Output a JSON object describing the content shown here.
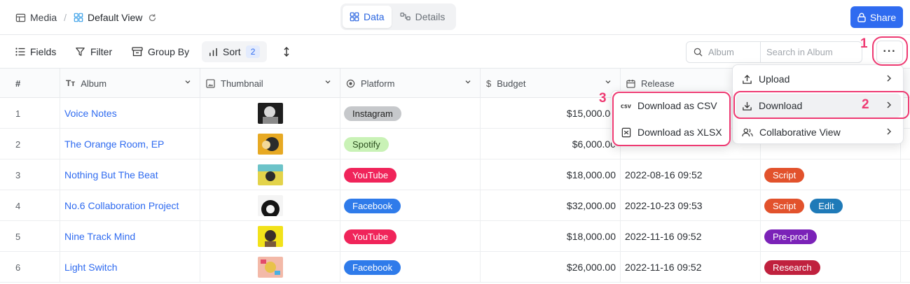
{
  "breadcrumb": {
    "root": "Media",
    "view": "Default View"
  },
  "view_switch": {
    "data_label": "Data",
    "details_label": "Details"
  },
  "share_label": "Share",
  "toolbar": {
    "fields": "Fields",
    "filter": "Filter",
    "group_by": "Group By",
    "sort": "Sort",
    "sort_count": "2"
  },
  "search": {
    "field_label": "Album",
    "placeholder": "Search in Album"
  },
  "more_label": "···",
  "columns": {
    "num": "#",
    "album": "Album",
    "thumbnail": "Thumbnail",
    "platform": "Platform",
    "budget": "Budget",
    "release": "Release"
  },
  "rows": [
    {
      "num": "1",
      "album": "Voice Notes",
      "platform": "Instagram",
      "budget": "$15,000.00",
      "release": "",
      "statuses": []
    },
    {
      "num": "2",
      "album": "The Orange Room, EP",
      "platform": "Spotify",
      "budget": "$6,000.00",
      "release": "",
      "statuses": []
    },
    {
      "num": "3",
      "album": "Nothing But The Beat",
      "platform": "YouTube",
      "budget": "$18,000.00",
      "release": "2022-08-16 09:52",
      "statuses": [
        "Script"
      ]
    },
    {
      "num": "4",
      "album": "No.6 Collaboration Project",
      "platform": "Facebook",
      "budget": "$32,000.00",
      "release": "2022-10-23 09:53",
      "statuses": [
        "Script",
        "Edit"
      ]
    },
    {
      "num": "5",
      "album": "Nine Track Mind",
      "platform": "YouTube",
      "budget": "$18,000.00",
      "release": "2022-11-16 09:52",
      "statuses": [
        "Pre-prod"
      ]
    },
    {
      "num": "6",
      "album": "Light Switch",
      "platform": "Facebook",
      "budget": "$26,000.00",
      "release": "2022-11-16 09:52",
      "statuses": [
        "Research"
      ]
    }
  ],
  "menu": {
    "upload": "Upload",
    "download": "Download",
    "collaborative": "Collaborative View"
  },
  "submenu": {
    "csv": "Download as CSV",
    "xlsx": "Download as XLSX"
  },
  "steps": {
    "one": "1",
    "two": "2",
    "three": "3"
  },
  "colors": {
    "accent": "#2f6bf0",
    "highlight": "#ee3a72"
  }
}
